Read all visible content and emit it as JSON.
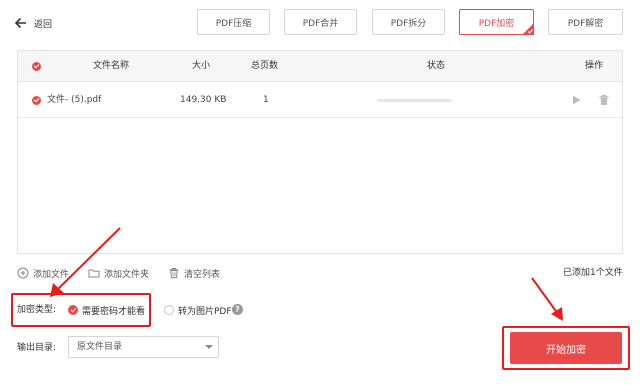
{
  "header": {
    "back_label": "返回",
    "tabs": [
      {
        "label": "PDF压缩",
        "active": false
      },
      {
        "label": "PDF合并",
        "active": false
      },
      {
        "label": "PDF拆分",
        "active": false
      },
      {
        "label": "PDF加密",
        "active": true
      },
      {
        "label": "PDF解密",
        "active": false
      }
    ]
  },
  "table": {
    "columns": {
      "name": "文件名称",
      "size": "大小",
      "pages": "总页数",
      "status": "状态",
      "actions": "操作"
    },
    "rows": [
      {
        "name": "文件- (5).pdf",
        "size": "149.30 KB",
        "pages": "1",
        "progress": 0,
        "checked": true
      }
    ]
  },
  "toolbar": {
    "add_file": "添加文件",
    "add_folder": "添加文件夹",
    "clear_list": "清空列表",
    "file_count": "已添加1个文件"
  },
  "options": {
    "encrypt_type_label": "加密类型:",
    "option_password": "需要密码才能看",
    "option_image_pdf": "转为图片PDF",
    "help_glyph": "?",
    "output_label": "输出目录:",
    "output_value": "原文件目录"
  },
  "start_button": "开始加密",
  "colors": {
    "accent": "#e84a4a",
    "highlight": "#e81c1c"
  }
}
